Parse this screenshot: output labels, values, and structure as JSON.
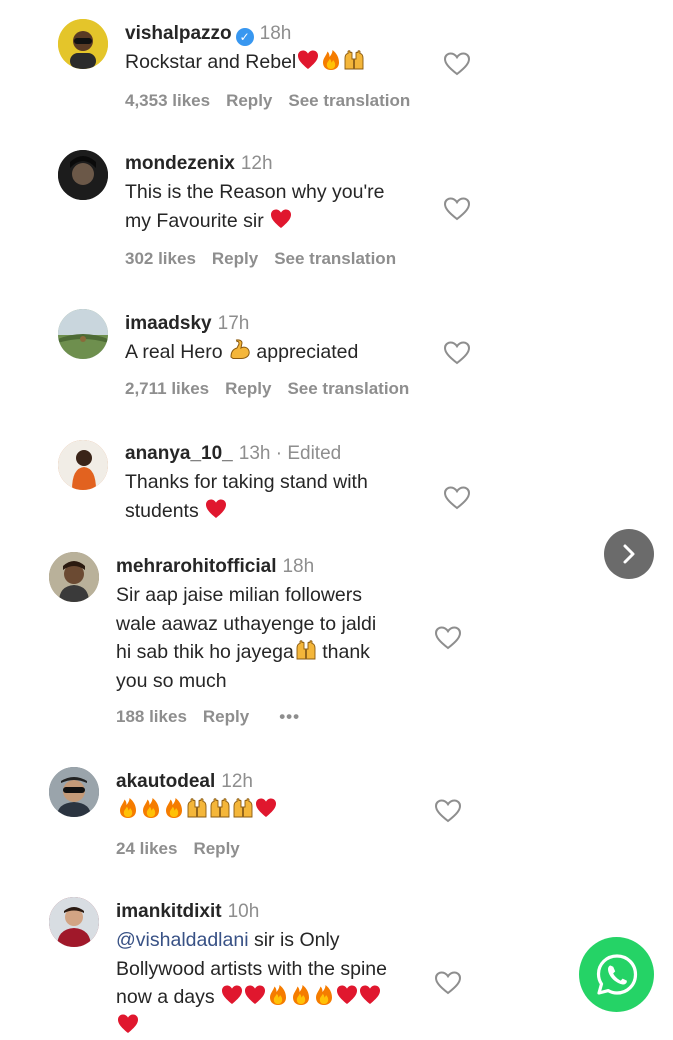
{
  "comments": [
    {
      "username": "vishalpazzo",
      "verified": true,
      "time": "18h",
      "lines": [
        "Rockstar and Rebel"
      ],
      "emoji": [
        "heart-emoji",
        "fire-emoji",
        "raising-hands-emoji"
      ],
      "likes": "4,353 likes",
      "reply": "Reply",
      "translate": "See translation",
      "avatar_color": "#e4c52a"
    },
    {
      "username": "mondezenix",
      "time": "12h",
      "lines": [
        "This is the Reason why you're",
        "my Favourite sir"
      ],
      "emoji": [
        "heart-emoji"
      ],
      "likes": "302 likes",
      "reply": "Reply",
      "translate": "See translation",
      "avatar_color": "#1c1c1c"
    },
    {
      "username": "imaadsky",
      "time": "17h",
      "lines_parts": [
        "A real Hero",
        "appreciated"
      ],
      "emoji": [
        "flexed-biceps-emoji"
      ],
      "likes": "2,711 likes",
      "reply": "Reply",
      "translate": "See translation",
      "avatar_color": "#7a9b6a"
    },
    {
      "username": "ananya_10_",
      "time": "13h · Edited",
      "lines": [
        "Thanks for taking stand with",
        "students"
      ],
      "emoji": [
        "heart-emoji"
      ],
      "avatar_color": "#d9773b"
    },
    {
      "username": "mehrarohitofficial",
      "time": "18h",
      "lines": [
        "Sir aap jaise milian followers",
        "wale aawaz uthayenge to jaldi",
        "hi sab thik ho jayega",
        "thank",
        "you so much"
      ],
      "emoji": [
        "raising-hands-emoji"
      ],
      "likes": "188 likes",
      "reply": "Reply",
      "more": "•••",
      "avatar_color": "#8a7a5a"
    },
    {
      "username": "akautodeal",
      "time": "12h",
      "emoji": [
        "fire-emoji",
        "fire-emoji",
        "fire-emoji",
        "raising-hands-emoji",
        "raising-hands-emoji",
        "raising-hands-emoji",
        "heart-emoji"
      ],
      "likes": "24 likes",
      "reply": "Reply",
      "avatar_color": "#5a6670"
    },
    {
      "username": "imankitdixit",
      "time": "10h",
      "mention": "@vishaldadlani",
      "lines": [
        "sir is Only",
        "Bollywood artists with the spine",
        "now a days"
      ],
      "emoji": [
        "heart-emoji",
        "heart-emoji",
        "fire-emoji",
        "fire-emoji",
        "fire-emoji",
        "heart-emoji",
        "heart-emoji",
        "heart-emoji"
      ],
      "avatar_color": "#8b2030"
    }
  ],
  "colors": {
    "text": "#262626",
    "muted": "#8e8e8e",
    "verified": "#3897f0",
    "mention": "#385185",
    "whatsapp": "#25d366",
    "next_button": "#6b6b6b"
  }
}
